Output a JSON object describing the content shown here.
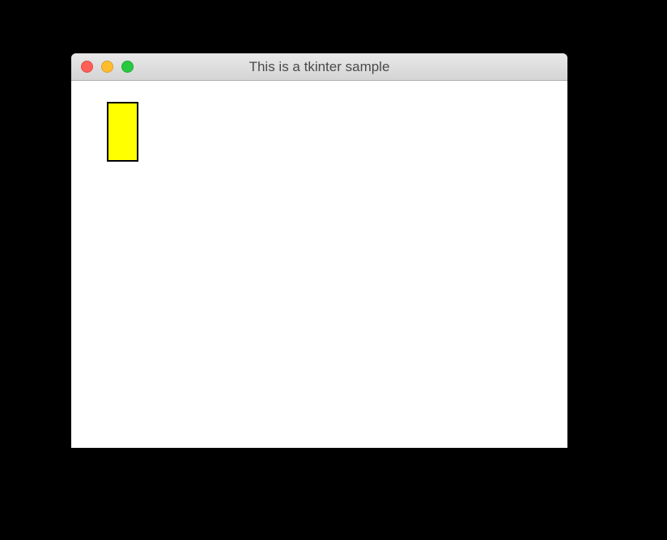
{
  "window": {
    "title": "This is a tkinter sample"
  },
  "canvas": {
    "rectangle": {
      "fill": "#ffff00",
      "stroke": "#000000"
    }
  }
}
